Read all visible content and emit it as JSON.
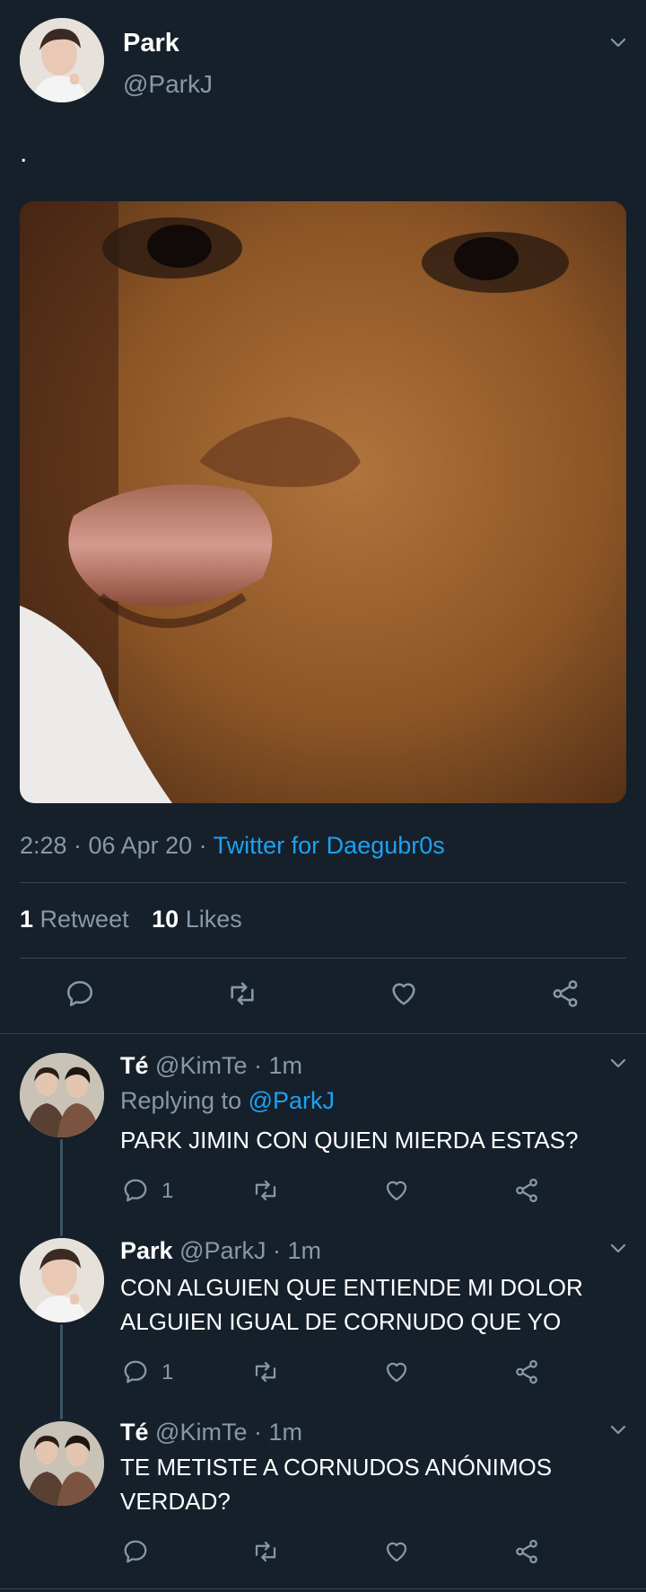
{
  "main_tweet": {
    "display_name": "Park",
    "handle": "@ParkJ",
    "text": ".",
    "timestamp": "2:28 · 06 Apr 20 · ",
    "source": "Twitter for Daegubr0s",
    "retweets_count": "1",
    "retweets_label": "Retweet",
    "likes_count": "10",
    "likes_label": "Likes"
  },
  "replies": [
    {
      "display_name": "Té",
      "handle": "@KimTe",
      "time": "· 1m",
      "replying_to_label": "Replying to ",
      "replying_to_handle": "@ParkJ",
      "text": "PARK JIMIN CON QUIEN MIERDA ESTAS?",
      "reply_count": "1"
    },
    {
      "display_name": "Park",
      "handle": "@ParkJ",
      "time": "· 1m",
      "text_line1": "CON ALGUIEN QUE ENTIENDE MI DOLOR",
      "text_line2": "ALGUIEN IGUAL DE CORNUDO QUE YO",
      "reply_count": "1"
    },
    {
      "display_name": "Té",
      "handle": "@KimTe",
      "time": "· 1m",
      "text_line1": "TE METISTE A CORNUDOS ANÓNIMOS",
      "text_line2": "VERDAD?",
      "reply_count": ""
    }
  ],
  "icons": {
    "reply": "reply-icon",
    "retweet": "retweet-icon",
    "like": "heart-icon",
    "share": "share-icon",
    "more": "chevron-down-icon"
  },
  "colors": {
    "background": "#15202b",
    "accent": "#1da1f2",
    "muted": "#8899a6",
    "divider": "#38444d"
  }
}
